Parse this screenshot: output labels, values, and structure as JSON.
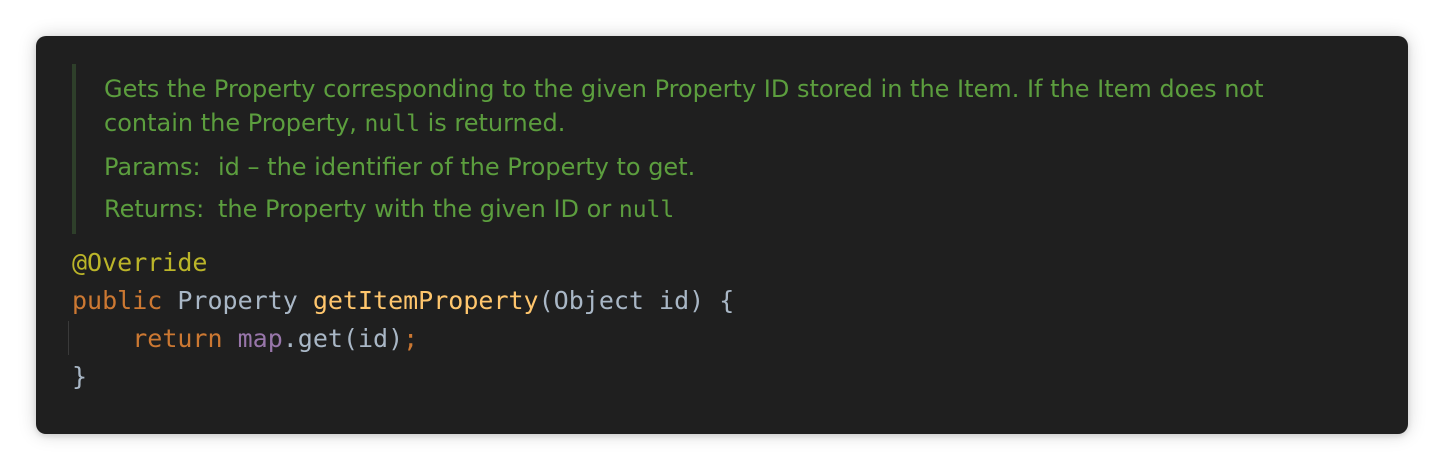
{
  "doc": {
    "line1": "Gets the Property corresponding to the given Property ID stored in the Item. If the Item does not",
    "line2_before": "contain the Property, ",
    "line2_code": "null",
    "line2_after": " is returned.",
    "params_label": "Params:",
    "params_text": "id – the identifier of the Property to get.",
    "returns_label": "Returns:",
    "returns_text": "the Property with the given ID or ",
    "returns_code": "null"
  },
  "code": {
    "annotation": "@Override",
    "public_kw": "public",
    "return_type": " Property ",
    "method_name": "getItemProperty",
    "params": "(Object id) {",
    "indent": "    ",
    "return_kw": "return",
    "space": " ",
    "map_field": "map",
    "call": ".get(id)",
    "semicolon": ";",
    "close_brace": "}"
  },
  "colors": {
    "background": "#1f1f1f",
    "doc_text": "#5c9e3e",
    "annotation": "#bbb529",
    "keyword": "#cc7832",
    "method": "#ffc66d",
    "field": "#9876aa",
    "plain": "#a9b7c6"
  }
}
